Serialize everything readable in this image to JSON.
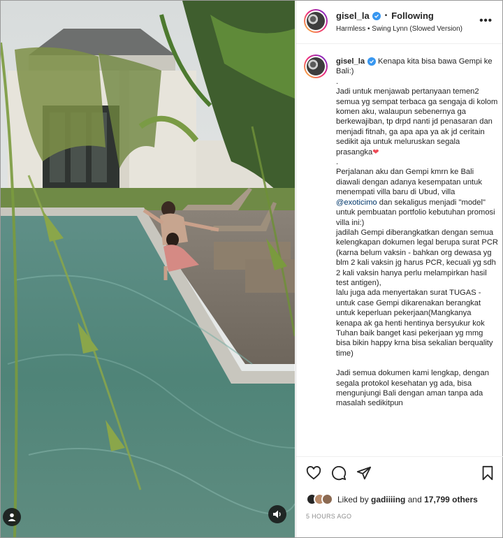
{
  "post": {
    "username": "gisel_la",
    "follow_status": "Following",
    "music": "Harmless • Swing Lynn (Slowed Version)",
    "more_label": "•••",
    "separator": "•"
  },
  "caption": {
    "username": "gisel_la",
    "p1": "Kenapa kita bisa bawa Gempi ke Bali:)",
    "p2": ".",
    "p3": "Jadi untuk menjawab pertanyaan temen2 semua yg sempat terbaca ga sengaja di kolom komen aku, walaupun sebenernya ga berkewajiban, tp drpd nanti jd penasaran dan menjadi fitnah, ga apa apa ya ak jd ceritain sedikit aja untuk meluruskan segala prasangka",
    "heart": "❤",
    "p4": ".",
    "p5a": "Perjalanan aku dan Gempi kmrn ke Bali diawali dengan adanya kesempatan untuk menempati villa baru di Ubud, villa",
    "mention": "@exoticimo",
    "p5b": "dan sekaligus menjadi \"model\" untuk pembuatan portfolio kebutuhan promosi villa ini:)",
    "p6": "jadilah Gempi diberangkatkan dengan semua kelengkapan dokumen legal berupa surat PCR (karna belum vaksin - bahkan org dewasa yg blm 2 kali vaksin jg harus PCR, kecuali yg sdh 2 kali vaksin hanya perlu melampirkan hasil test antigen),",
    "p7": "lalu juga ada menyertakan surat TUGAS - untuk case Gempi dikarenakan berangkat untuk keperluan pekerjaan(Mangkanya kenapa ak ga henti hentinya bersyukur kok Tuhan baik banget kasi pekerjaan yg mmg bisa bikin happy krna bisa sekalian berquality time)",
    "p8": "Jadi semua dokumen kami lengkap, dengan segala protokol kesehatan yg ada, bisa mengunjungi Bali dengan aman tanpa ada masalah sedikitpun"
  },
  "likes": {
    "prefix": "Liked by",
    "user": "gadiiiing",
    "connector": "and",
    "count": "17,799 others"
  },
  "timestamp": "5 HOURS AGO",
  "icons": {
    "like": "heart-icon",
    "comment": "comment-icon",
    "share": "share-icon",
    "save": "bookmark-icon",
    "tag": "user-tag-icon",
    "audio": "speaker-icon",
    "verified": "verified-badge-icon"
  },
  "colors": {
    "accent": "#3897f0",
    "link": "#00376b",
    "heart": "#ed4956",
    "muted": "#8e8e8e"
  }
}
